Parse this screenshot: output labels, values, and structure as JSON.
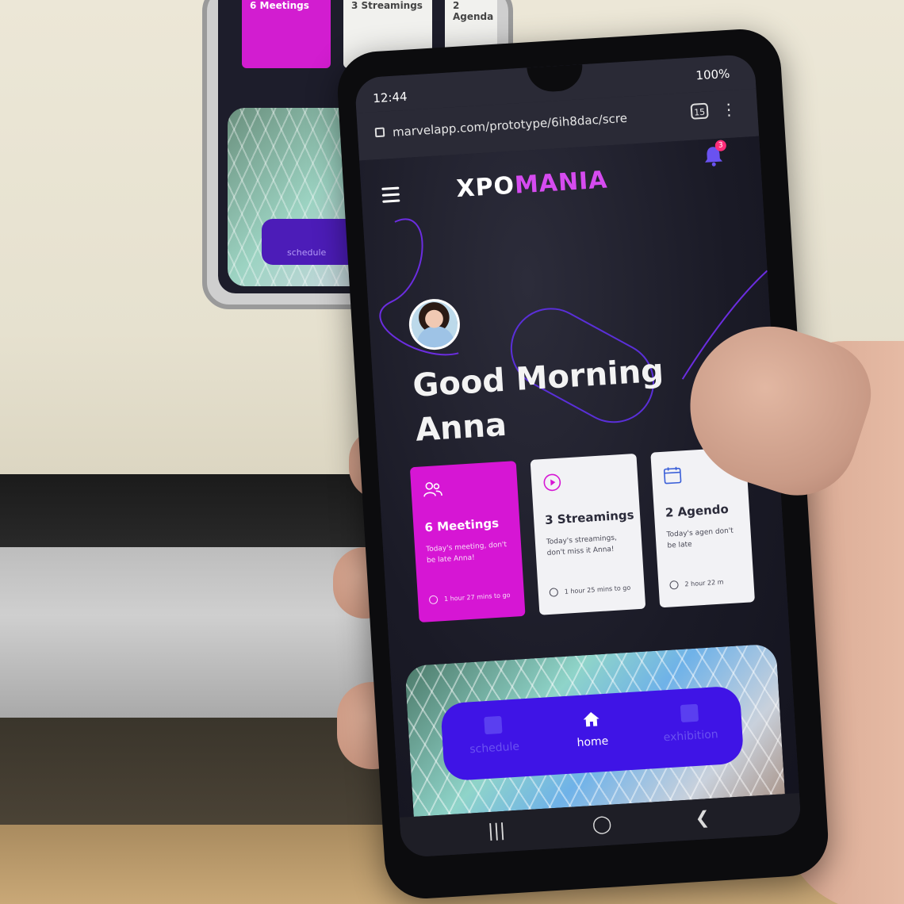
{
  "status_bar": {
    "time": "12:44",
    "battery": "100%"
  },
  "browser": {
    "url": "marvelapp.com/prototype/6ih8dac/scre",
    "tab_count": "15"
  },
  "app": {
    "logo_part1": "XPO",
    "logo_part2": "MANIA",
    "notification_count": "3",
    "greeting_line1": "Good Morning",
    "greeting_line2": "Anna"
  },
  "cards": [
    {
      "title": "6 Meetings",
      "desc": "Today's meeting, don't be late Anna!",
      "eta": "1 hour 27 mins to go"
    },
    {
      "title": "3 Streamings",
      "desc": "Today's streamings, don't miss it Anna!",
      "eta": "1 hour 25 mins to go"
    },
    {
      "title": "2 Agendo",
      "desc": "Today's agen don't be late",
      "eta": "2 hour 22 m"
    }
  ],
  "nav": {
    "schedule": "schedule",
    "home": "home",
    "exhibition": "exhibition"
  },
  "background_display": {
    "card1": "6 Meetings",
    "card2": "3 Streamings",
    "card3": "2 Agenda",
    "nav_label": "schedule"
  },
  "colors": {
    "accent_magenta": "#d616d4",
    "nav_blue": "#3f14e6",
    "logo_pink": "#d64bf0"
  }
}
